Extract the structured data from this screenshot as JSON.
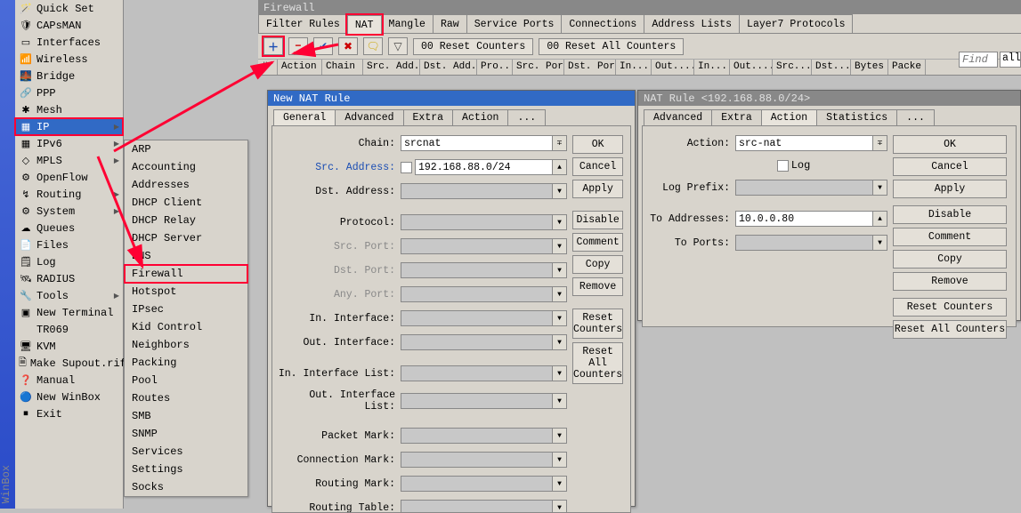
{
  "app_name": "WinBox",
  "sidebar": {
    "items": [
      {
        "label": "Quick Set",
        "icon": "🪄"
      },
      {
        "label": "CAPsMAN",
        "icon": "🛡"
      },
      {
        "label": "Interfaces",
        "icon": "▭"
      },
      {
        "label": "Wireless",
        "icon": "📶"
      },
      {
        "label": "Bridge",
        "icon": "🌉"
      },
      {
        "label": "PPP",
        "icon": "🔗"
      },
      {
        "label": "Mesh",
        "icon": "✱"
      },
      {
        "label": "IP",
        "icon": "▦",
        "caret": true,
        "red": true,
        "hover": true
      },
      {
        "label": "IPv6",
        "icon": "▦",
        "caret": true
      },
      {
        "label": "MPLS",
        "icon": "◇",
        "caret": true
      },
      {
        "label": "OpenFlow",
        "icon": "⚙"
      },
      {
        "label": "Routing",
        "icon": "↯",
        "caret": true
      },
      {
        "label": "System",
        "icon": "⚙",
        "caret": true
      },
      {
        "label": "Queues",
        "icon": "☁"
      },
      {
        "label": "Files",
        "icon": "📄"
      },
      {
        "label": "Log",
        "icon": "🗒"
      },
      {
        "label": "RADIUS",
        "icon": "🛰"
      },
      {
        "label": "Tools",
        "icon": "🔧",
        "caret": true
      },
      {
        "label": "New Terminal",
        "icon": "▣"
      },
      {
        "label": "TR069",
        "icon": " "
      },
      {
        "label": "KVM",
        "icon": "🖥"
      },
      {
        "label": "Make Supout.rif",
        "icon": "🗎"
      },
      {
        "label": "Manual",
        "icon": "❓"
      },
      {
        "label": "New WinBox",
        "icon": "🔵"
      },
      {
        "label": "Exit",
        "icon": "⏹"
      }
    ]
  },
  "submenu": {
    "items": [
      "ARP",
      "Accounting",
      "Addresses",
      "DHCP Client",
      "DHCP Relay",
      "DHCP Server",
      "DNS",
      "Firewall",
      "Hotspot",
      "IPsec",
      "Kid Control",
      "Neighbors",
      "Packing",
      "Pool",
      "Routes",
      "SMB",
      "SNMP",
      "Services",
      "Settings",
      "Socks"
    ]
  },
  "firewall": {
    "title": "Firewall",
    "tabs": [
      "Filter Rules",
      "NAT",
      "Mangle",
      "Raw",
      "Service Ports",
      "Connections",
      "Address Lists",
      "Layer7 Protocols"
    ],
    "active_tab": "NAT",
    "toolbar": {
      "add": "＋",
      "remove": "−",
      "enable": "✔",
      "disable": "✖",
      "comment": "🗨",
      "filter": "▽",
      "reset": "00 Reset Counters",
      "reset_all": "00 Reset All Counters"
    },
    "find_placeholder": "Find",
    "all_label": "all",
    "columns": [
      "#",
      "Action",
      "Chain",
      "Src. Add...",
      "Dst. Add...",
      "Pro...",
      "Src. Port",
      "Dst. Port",
      "In....",
      "Out....",
      "In....",
      "Out....",
      "Src....",
      "Dst....",
      "Bytes",
      "Packe"
    ]
  },
  "new_rule": {
    "title": "New NAT Rule",
    "tabs": [
      "General",
      "Advanced",
      "Extra",
      "Action",
      "..."
    ],
    "active": "General",
    "labels": {
      "chain": "Chain:",
      "src": "Src. Address:",
      "dst": "Dst. Address:",
      "proto": "Protocol:",
      "srcp": "Src. Port:",
      "dstp": "Dst. Port:",
      "anyp": "Any. Port:",
      "inif": "In. Interface:",
      "outif": "Out. Interface:",
      "inil": "In. Interface List:",
      "outil": "Out. Interface List:",
      "pkt": "Packet Mark:",
      "conn": "Connection Mark:",
      "rmark": "Routing Mark:",
      "rtable": "Routing Table:"
    },
    "values": {
      "chain": "srcnat",
      "src": "192.168.88.0/24"
    },
    "buttons": [
      "OK",
      "Cancel",
      "Apply",
      "Disable",
      "Comment",
      "Copy",
      "Remove",
      "Reset Counters",
      "Reset All Counters"
    ]
  },
  "edit_rule": {
    "title": "NAT Rule <192.168.88.0/24>",
    "tabs": [
      "Advanced",
      "Extra",
      "Action",
      "Statistics",
      "..."
    ],
    "active": "Action",
    "labels": {
      "action": "Action:",
      "log": "Log",
      "logp": "Log Prefix:",
      "toaddr": "To Addresses:",
      "toport": "To Ports:"
    },
    "values": {
      "action": "src-nat",
      "toaddr": "10.0.0.80"
    },
    "buttons": [
      "OK",
      "Cancel",
      "Apply",
      "Disable",
      "Comment",
      "Copy",
      "Remove",
      "Reset Counters",
      "Reset All Counters"
    ]
  }
}
